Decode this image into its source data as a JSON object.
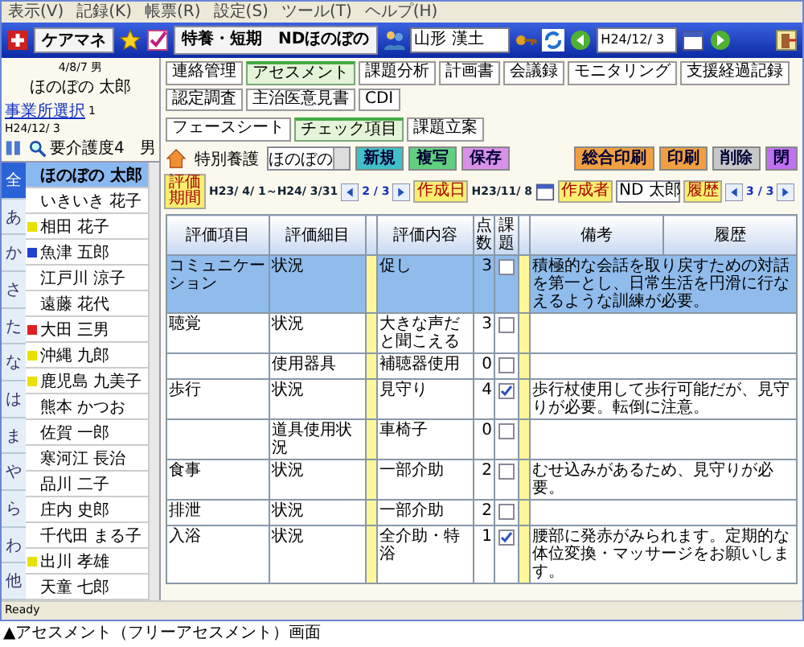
{
  "menu": [
    "表示(V)",
    "記録(K)",
    "帳票(R)",
    "設定(S)",
    "ツール(T)",
    "ヘルプ(H)"
  ],
  "toolbar": {
    "app_button": "ケアマネ",
    "facility": "特養・短期　NDほのぼの",
    "staff": "山形 漢土",
    "date": "H24/12/ 3"
  },
  "patient": {
    "birth": "4/8/7",
    "sex": "男",
    "name": "ほのぼの 太郎"
  },
  "list_info": {
    "link": "事業所選択",
    "counter": "1",
    "date": "H24/12/ 3",
    "care_level": "要介護度4",
    "sex": "男"
  },
  "tabs": [
    {
      "label": "連絡管理",
      "selected": false
    },
    {
      "label": "アセスメント",
      "selected": true
    },
    {
      "label": "課題分析",
      "selected": false
    },
    {
      "label": "計画書",
      "selected": false
    },
    {
      "label": "会議録",
      "selected": false
    },
    {
      "label": "モニタリング",
      "selected": false
    },
    {
      "label": "支援経過記録",
      "selected": false
    },
    {
      "label": "認定調査",
      "selected": false
    },
    {
      "label": "主治医意見書",
      "selected": false
    },
    {
      "label": "CDI",
      "selected": false
    }
  ],
  "subtabs": [
    {
      "label": "フェースシート",
      "selected": false
    },
    {
      "label": "チェック項目",
      "selected": true
    },
    {
      "label": "課題立案",
      "selected": false
    }
  ],
  "service": {
    "type": "特別養護",
    "office": "ほのぼの"
  },
  "actions": [
    {
      "label": "新規",
      "color": "#40c0c8"
    },
    {
      "label": "複写",
      "color": "#60d080"
    },
    {
      "label": "保存",
      "color": "#d890e8"
    }
  ],
  "print_actions": [
    {
      "label": "総合印刷",
      "color": "#f0a040"
    },
    {
      "label": "印刷",
      "color": "#f0a040"
    },
    {
      "label": "削除",
      "color": "#c8c8c8"
    },
    {
      "label": "閉",
      "color": "#c070f0"
    }
  ],
  "period": {
    "label": "評価期間",
    "range": "H23/ 4/ 1～H24/ 3/31",
    "page": "2 / 3",
    "created_label": "作成日",
    "created": "H23/11/ 8",
    "author_label": "作成者",
    "author": "ND 太郎",
    "history_label": "履歴",
    "history_page": "3 / 3"
  },
  "index_tabs": [
    {
      "label": "全",
      "selected": true
    },
    {
      "label": "あ",
      "selected": false
    },
    {
      "label": "か",
      "selected": false
    },
    {
      "label": "さ",
      "selected": false
    },
    {
      "label": "た",
      "selected": false
    },
    {
      "label": "な",
      "selected": false
    },
    {
      "label": "は",
      "selected": false
    },
    {
      "label": "ま",
      "selected": false
    },
    {
      "label": "や",
      "selected": false
    },
    {
      "label": "ら",
      "selected": false
    },
    {
      "label": "わ",
      "selected": false
    },
    {
      "label": "他",
      "selected": false
    }
  ],
  "residents": [
    {
      "name": "ほのぼの 太郎",
      "selected": true
    },
    {
      "name": "いきいき 花子",
      "selected": false
    },
    {
      "name": "相田 花子",
      "selected": false,
      "color": "#e8e000"
    },
    {
      "name": "魚津 五郎",
      "selected": false,
      "color": "#2040d0"
    },
    {
      "name": "江戸川 涼子",
      "selected": false
    },
    {
      "name": "遠藤 花代",
      "selected": false
    },
    {
      "name": "大田 三男",
      "selected": false,
      "color": "#e02020"
    },
    {
      "name": "沖縄 九郎",
      "selected": false,
      "color": "#e8e000"
    },
    {
      "name": "鹿児島 九美子",
      "selected": false,
      "color": "#e8e000"
    },
    {
      "name": "熊本 かつお",
      "selected": false
    },
    {
      "name": "佐賀 一郎",
      "selected": false
    },
    {
      "name": "寒河江 長治",
      "selected": false
    },
    {
      "name": "品川 二子",
      "selected": false
    },
    {
      "name": "庄内 史郎",
      "selected": false
    },
    {
      "name": "千代田 まる子",
      "selected": false
    },
    {
      "name": "出川 孝雄",
      "selected": false,
      "color": "#e8e000"
    },
    {
      "name": "天童 七郎",
      "selected": false
    }
  ],
  "table": {
    "columns": [
      "評価項目",
      "評価細目",
      "評価内容",
      "点数",
      "課題",
      "備考",
      "履歴"
    ],
    "rows": [
      {
        "item": "コミュニケーション",
        "detail": "状況",
        "content": "促し",
        "score": "3",
        "issue": false,
        "note": "積極的な会話を取り戻すための対話を第一とし、日常生活を円滑に行なえるような訓練が必要。",
        "selected": true
      },
      {
        "item": "聴覚",
        "detail": "状況",
        "content": "大きな声だと聞こえる",
        "score": "3",
        "issue": false,
        "selected": false
      },
      {
        "detail": "使用器具",
        "content": "補聴器使用",
        "score": "0",
        "issue": false,
        "selected": false
      },
      {
        "item": "歩行",
        "detail": "状況",
        "content": "見守り",
        "score": "4",
        "issue": true,
        "note": "歩行杖使用して歩行可能だが、見守りが必要。転倒に注意。",
        "selected": false
      },
      {
        "detail": "道具使用状況",
        "content": "車椅子",
        "score": "0",
        "issue": false,
        "selected": false
      },
      {
        "item": "食事",
        "detail": "状況",
        "content": "一部介助",
        "score": "2",
        "issue": false,
        "note": "むせ込みがあるため、見守りが必要。",
        "selected": false
      },
      {
        "item": "排泄",
        "detail": "状況",
        "content": "一部介助",
        "score": "2",
        "issue": false,
        "selected": false
      },
      {
        "item": "入浴",
        "detail": "状況",
        "content": "全介助・特浴",
        "score": "1",
        "issue": true,
        "note": "腰部に発赤がみられます。定期的な体位変換・マッサージをお願いします。",
        "selected": false
      }
    ]
  },
  "status_bar": "Ready",
  "caption": "▲アセスメント（フリーアセスメント）画面"
}
